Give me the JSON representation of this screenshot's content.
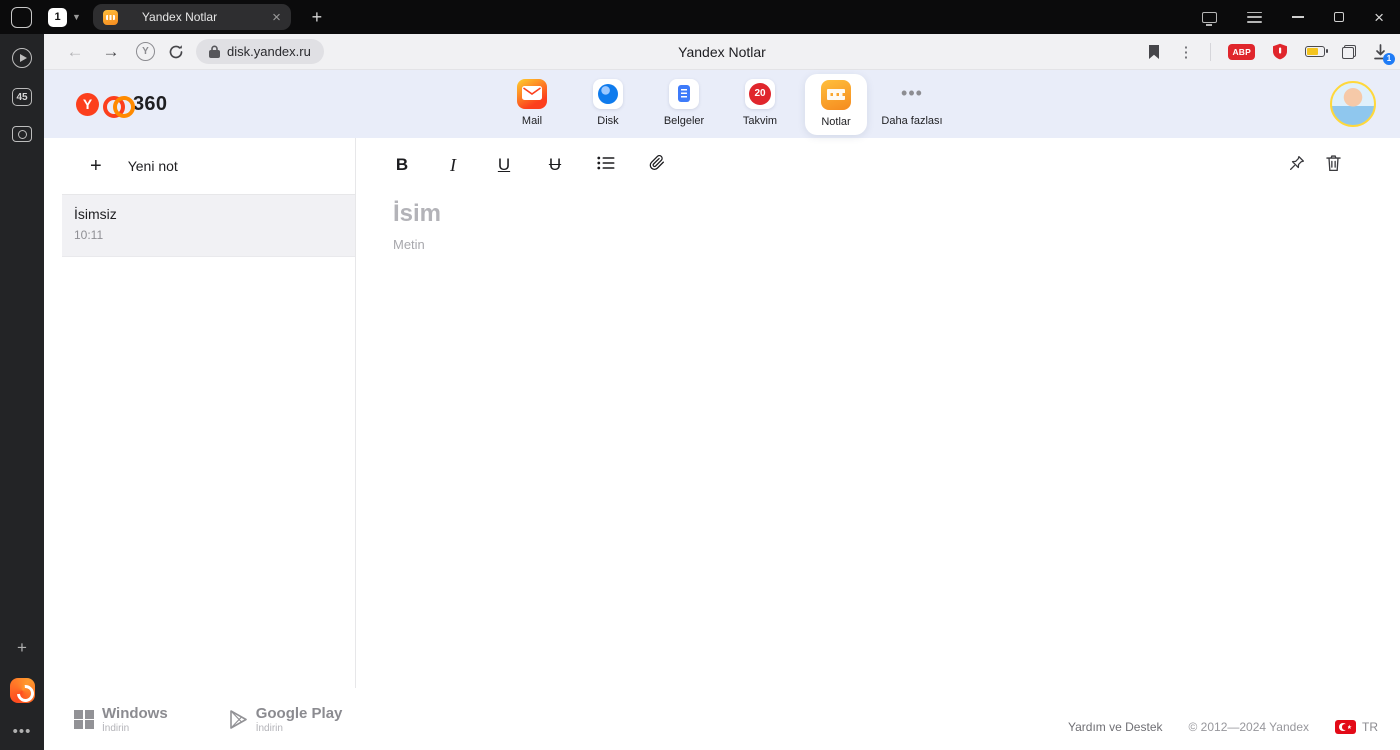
{
  "browser": {
    "tabbar": {
      "tab_count": "1",
      "tab_title": "Yandex Notlar"
    },
    "toolbar": {
      "url": "disk.yandex.ru",
      "page_title": "Yandex Notlar",
      "abp": "ABP",
      "download_badge": "1"
    },
    "sidebar": {
      "counter": "45"
    }
  },
  "app": {
    "header": {
      "brand": "360",
      "nav": [
        {
          "label": "Mail"
        },
        {
          "label": "Disk"
        },
        {
          "label": "Belgeler"
        },
        {
          "label": "Takvim",
          "badge": "20"
        },
        {
          "label": "Notlar"
        },
        {
          "label": "Daha fazlası"
        }
      ]
    },
    "notes": {
      "new_note": "Yeni not",
      "items": [
        {
          "title": "İsimsiz",
          "time": "10:11"
        }
      ]
    },
    "editor": {
      "toolbar": {
        "bold": "B",
        "italic": "I",
        "underline": "U",
        "strikethrough": "U"
      },
      "title_placeholder": "İsim",
      "body_placeholder": "Metin"
    },
    "footer": {
      "windows_title": "Windows",
      "windows_sub": "İndirin",
      "gplay_title": "Google Play",
      "gplay_sub": "İndirin",
      "help": "Yardım ve Destek",
      "copyright": "© 2012—2024 Yandex",
      "lang": "TR"
    }
  }
}
